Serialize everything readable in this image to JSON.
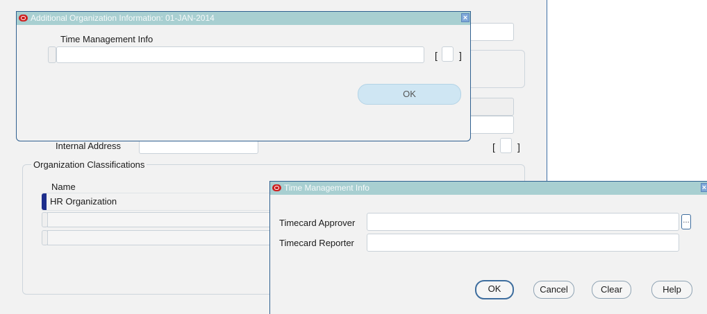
{
  "background_form": {
    "internal_address_label": "Internal Address",
    "internal_address_value": "",
    "classifications_legend": "Organization Classifications",
    "column_name": "Name",
    "rows": [
      "HR Organization",
      "",
      ""
    ],
    "bracket_left": "[",
    "bracket_right": "]"
  },
  "dialog_additional": {
    "title": "Additional Organization Information: 01-JAN-2014",
    "field_label": "Time Management Info",
    "field_value": "",
    "bracket_left": "[",
    "bracket_right": "]",
    "ok_label": "OK",
    "close_glyph": "×"
  },
  "dialog_time": {
    "title": "Time Management Info",
    "approver_label": "Timecard Approver",
    "approver_value": "",
    "reporter_label": "Timecard Reporter",
    "reporter_value": "",
    "lov_glyph": "…",
    "ok_label": "OK",
    "cancel_label": "Cancel",
    "clear_label": "Clear",
    "help_label": "Help",
    "close_glyph": "×"
  },
  "colors": {
    "titlebar": "#a8cfd1",
    "oracle_red": "#cc1f1f",
    "selection_marker": "#1e2e8c"
  },
  "icons": [
    "oracle-logo-icon",
    "close-icon",
    "lov-ellipsis-icon"
  ]
}
